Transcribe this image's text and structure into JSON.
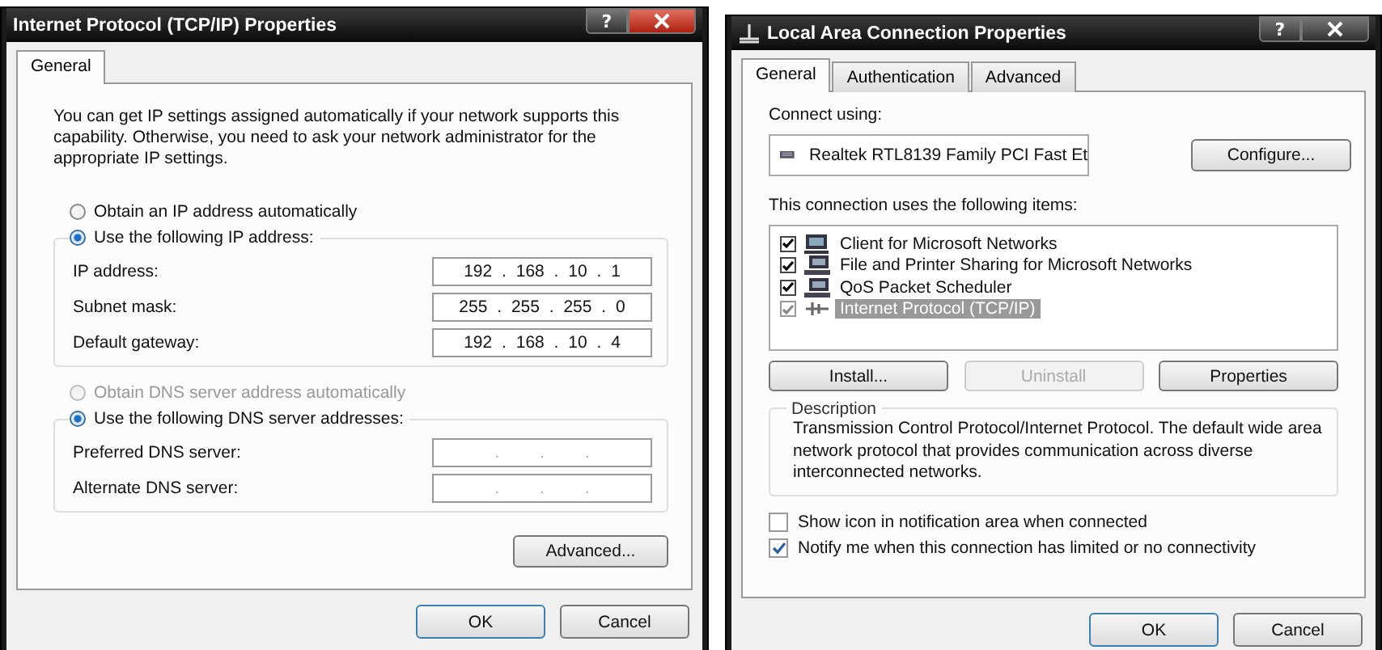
{
  "ip_dialog": {
    "title": "Internet Protocol (TCP/IP) Properties",
    "help": "?",
    "tabs": [
      {
        "label": "General",
        "selected": true
      }
    ],
    "intro": "You can get IP settings assigned automatically if your network supports this capability. Otherwise, you need to ask your network administrator for the appropriate IP settings.",
    "ip_options": [
      {
        "label": "Obtain an IP address automatically",
        "selected": false,
        "disabled": false
      },
      {
        "label": "Use the following IP address:",
        "selected": true,
        "disabled": false
      }
    ],
    "ip_fields": [
      {
        "label": "IP address:",
        "value": "192 . 168 . 10 . 1"
      },
      {
        "label": "Subnet mask:",
        "value": "255 . 255 . 255 . 0"
      },
      {
        "label": "Default gateway:",
        "value": "192 . 168 . 10 . 4"
      }
    ],
    "dns_options": [
      {
        "label": "Obtain DNS server address automatically",
        "selected": false,
        "disabled": true
      },
      {
        "label": "Use the following DNS server addresses:",
        "selected": true,
        "disabled": false
      }
    ],
    "dns_fields": [
      {
        "label": "Preferred DNS server:",
        "value": ". . ."
      },
      {
        "label": "Alternate DNS server:",
        "value": ". . ."
      }
    ],
    "advanced": "Advanced...",
    "buttons": [
      {
        "label": "OK",
        "default": true
      },
      {
        "label": "Cancel",
        "default": false
      }
    ]
  },
  "lan_dialog": {
    "title": "Local Area Connection Properties",
    "help": "?",
    "tabs": [
      {
        "label": "General",
        "selected": true
      },
      {
        "label": "Authentication",
        "selected": false
      },
      {
        "label": "Advanced",
        "selected": false
      }
    ],
    "connect_label": "Connect using:",
    "adapter": "Realtek RTL8139 Family PCI Fast Et",
    "configure": "Configure...",
    "items_label": "This connection uses the following items:",
    "items": [
      {
        "label": "Client for Microsoft Networks",
        "kind": "client",
        "checked": true,
        "selected": false
      },
      {
        "label": "File and Printer Sharing for Microsoft Networks",
        "kind": "service",
        "checked": true,
        "selected": false
      },
      {
        "label": "QoS Packet Scheduler",
        "kind": "service",
        "checked": true,
        "selected": false
      },
      {
        "label": "Internet Protocol (TCP/IP)",
        "kind": "protocol",
        "checked": true,
        "selected": true
      }
    ],
    "item_buttons": [
      {
        "label": "Install...",
        "disabled": false
      },
      {
        "label": "Uninstall",
        "disabled": true
      },
      {
        "label": "Properties",
        "disabled": false
      }
    ],
    "description_title": "Description",
    "description": "Transmission Control Protocol/Internet Protocol. The default wide area network protocol that provides communication across diverse interconnected networks.",
    "options": [
      {
        "label": "Show icon in notification area when connected",
        "checked": false
      },
      {
        "label": "Notify me when this connection has limited or no connectivity",
        "checked": true
      }
    ],
    "buttons": [
      {
        "label": "OK",
        "default": true
      },
      {
        "label": "Cancel",
        "default": false
      }
    ]
  }
}
